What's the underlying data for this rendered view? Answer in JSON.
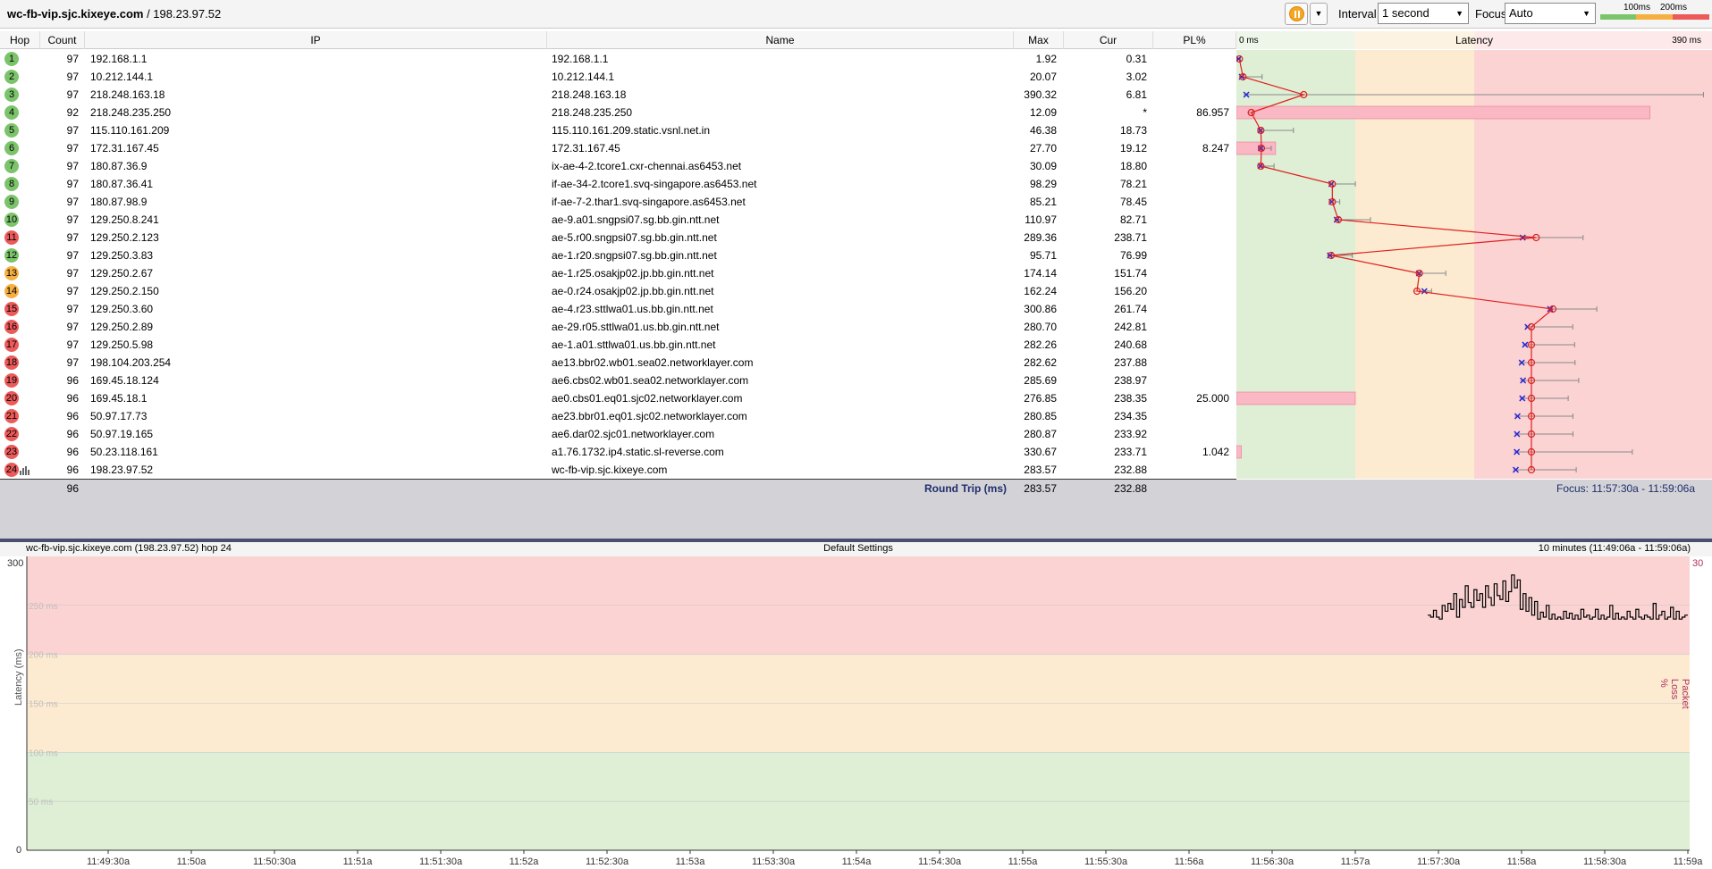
{
  "toolbar": {
    "target_host": "wc-fb-vip.sjc.kixeye.com",
    "target_ip": " / 198.23.97.52",
    "interval_label": "Interval",
    "interval_value": "1 second",
    "focus_label": "Focus",
    "focus_value": "Auto",
    "legend_100": "100ms",
    "legend_200": "200ms"
  },
  "columns": {
    "hop": "Hop",
    "count": "Count",
    "ip": "IP",
    "name": "Name",
    "max": "Max",
    "cur": "Cur",
    "pl": "PL%",
    "latency": "Latency",
    "latency_min": "0 ms",
    "latency_max": "390 ms"
  },
  "hops": [
    {
      "hop": "1",
      "count": "97",
      "ip": "192.168.1.1",
      "name": "192.168.1.1",
      "max": "1.92",
      "cur": "0.31",
      "pl": "",
      "status": "green",
      "avg": 1.0
    },
    {
      "hop": "2",
      "count": "97",
      "ip": "10.212.144.1",
      "name": "10.212.144.1",
      "max": "20.07",
      "cur": "3.02",
      "pl": "",
      "status": "green",
      "avg": 4.0
    },
    {
      "hop": "3",
      "count": "97",
      "ip": "218.248.163.18",
      "name": "218.248.163.18",
      "max": "390.32",
      "cur": "6.81",
      "pl": "",
      "status": "green",
      "avg": 55.0
    },
    {
      "hop": "4",
      "count": "92",
      "ip": "218.248.235.250",
      "name": "218.248.235.250",
      "max": "12.09",
      "cur": "*",
      "pl": "86.957",
      "status": "green",
      "avg": 11.0
    },
    {
      "hop": "5",
      "count": "97",
      "ip": "115.110.161.209",
      "name": "115.110.161.209.static.vsnl.net.in",
      "max": "46.38",
      "cur": "18.73",
      "pl": "",
      "status": "green",
      "avg": 19.0
    },
    {
      "hop": "6",
      "count": "97",
      "ip": "172.31.167.45",
      "name": "172.31.167.45",
      "max": "27.70",
      "cur": "19.12",
      "pl": "8.247",
      "status": "green",
      "avg": 19.5
    },
    {
      "hop": "7",
      "count": "97",
      "ip": "180.87.36.9",
      "name": "ix-ae-4-2.tcore1.cxr-chennai.as6453.net",
      "max": "30.09",
      "cur": "18.80",
      "pl": "",
      "status": "green",
      "avg": 19.0
    },
    {
      "hop": "8",
      "count": "97",
      "ip": "180.87.36.41",
      "name": "if-ae-34-2.tcore1.svq-singapore.as6453.net",
      "max": "98.29",
      "cur": "78.21",
      "pl": "",
      "status": "green",
      "avg": 79.0
    },
    {
      "hop": "9",
      "count": "97",
      "ip": "180.87.98.9",
      "name": "if-ae-7-2.thar1.svq-singapore.as6453.net",
      "max": "85.21",
      "cur": "78.45",
      "pl": "",
      "status": "green",
      "avg": 79.0
    },
    {
      "hop": "10",
      "count": "97",
      "ip": "129.250.8.241",
      "name": "ae-9.a01.sngpsi07.sg.bb.gin.ntt.net",
      "max": "110.97",
      "cur": "82.71",
      "pl": "",
      "status": "green",
      "avg": 84.0
    },
    {
      "hop": "11",
      "count": "97",
      "ip": "129.250.2.123",
      "name": "ae-5.r00.sngpsi07.sg.bb.gin.ntt.net",
      "max": "289.36",
      "cur": "238.71",
      "pl": "",
      "status": "red",
      "avg": 250.0
    },
    {
      "hop": "12",
      "count": "97",
      "ip": "129.250.3.83",
      "name": "ae-1.r20.sngpsi07.sg.bb.gin.ntt.net",
      "max": "95.71",
      "cur": "76.99",
      "pl": "",
      "status": "green",
      "avg": 78.0
    },
    {
      "hop": "13",
      "count": "97",
      "ip": "129.250.2.67",
      "name": "ae-1.r25.osakjp02.jp.bb.gin.ntt.net",
      "max": "174.14",
      "cur": "151.74",
      "pl": "",
      "status": "orange",
      "avg": 152.0
    },
    {
      "hop": "14",
      "count": "97",
      "ip": "129.250.2.150",
      "name": "ae-0.r24.osakjp02.jp.bb.gin.ntt.net",
      "max": "162.24",
      "cur": "156.20",
      "pl": "",
      "status": "orange",
      "avg": 150.0
    },
    {
      "hop": "15",
      "count": "97",
      "ip": "129.250.3.60",
      "name": "ae-4.r23.sttlwa01.us.bb.gin.ntt.net",
      "max": "300.86",
      "cur": "261.74",
      "pl": "",
      "status": "red",
      "avg": 264.0
    },
    {
      "hop": "16",
      "count": "97",
      "ip": "129.250.2.89",
      "name": "ae-29.r05.sttlwa01.us.bb.gin.ntt.net",
      "max": "280.70",
      "cur": "242.81",
      "pl": "",
      "status": "red",
      "avg": 246.0
    },
    {
      "hop": "17",
      "count": "97",
      "ip": "129.250.5.98",
      "name": "ae-1.a01.sttlwa01.us.bb.gin.ntt.net",
      "max": "282.26",
      "cur": "240.68",
      "pl": "",
      "status": "red",
      "avg": 246.0
    },
    {
      "hop": "18",
      "count": "97",
      "ip": "198.104.203.254",
      "name": "ae13.bbr02.wb01.sea02.networklayer.com",
      "max": "282.62",
      "cur": "237.88",
      "pl": "",
      "status": "red",
      "avg": 246.0
    },
    {
      "hop": "19",
      "count": "96",
      "ip": "169.45.18.124",
      "name": "ae6.cbs02.wb01.sea02.networklayer.com",
      "max": "285.69",
      "cur": "238.97",
      "pl": "",
      "status": "red",
      "avg": 246.0
    },
    {
      "hop": "20",
      "count": "96",
      "ip": "169.45.18.1",
      "name": "ae0.cbs01.eq01.sjc02.networklayer.com",
      "max": "276.85",
      "cur": "238.35",
      "pl": "25.000",
      "status": "red",
      "avg": 246.0
    },
    {
      "hop": "21",
      "count": "96",
      "ip": "50.97.17.73",
      "name": "ae23.bbr01.eq01.sjc02.networklayer.com",
      "max": "280.85",
      "cur": "234.35",
      "pl": "",
      "status": "red",
      "avg": 246.0
    },
    {
      "hop": "22",
      "count": "96",
      "ip": "50.97.19.165",
      "name": "ae6.dar02.sjc01.networklayer.com",
      "max": "280.87",
      "cur": "233.92",
      "pl": "",
      "status": "red",
      "avg": 246.0
    },
    {
      "hop": "23",
      "count": "96",
      "ip": "50.23.118.161",
      "name": "a1.76.1732.ip4.static.sl-reverse.com",
      "max": "330.67",
      "cur": "233.71",
      "pl": "1.042",
      "status": "red",
      "avg": 246.0
    },
    {
      "hop": "24",
      "count": "96",
      "ip": "198.23.97.52",
      "name": "wc-fb-vip.sjc.kixeye.com",
      "max": "283.57",
      "cur": "232.88",
      "pl": "",
      "status": "red",
      "avg": 246.0
    }
  ],
  "summary": {
    "count": "96",
    "label": "Round Trip (ms)",
    "max": "283.57",
    "cur": "232.88",
    "focus_range": "Focus: 11:57:30a - 11:59:06a"
  },
  "history": {
    "title": "wc-fb-vip.sjc.kixeye.com (198.23.97.52) hop 24",
    "settings": "Default Settings",
    "range": "10 minutes (11:49:06a - 11:59:06a)",
    "y_axis_title": "Latency (ms)",
    "right_axis_title": "Packet Loss %",
    "y_top": "300",
    "y_bottom": "0",
    "y_right_top": "30",
    "gridline_labels": [
      "250 ms",
      "200 ms",
      "150 ms",
      "100 ms",
      "50 ms"
    ],
    "time_labels": [
      "11:49:30a",
      "11:50a",
      "11:50:30a",
      "11:51a",
      "11:51:30a",
      "11:52a",
      "11:52:30a",
      "11:53a",
      "11:53:30a",
      "11:54a",
      "11:54:30a",
      "11:55a",
      "11:55:30a",
      "11:56a",
      "11:56:30a",
      "11:57a",
      "11:57:30a",
      "11:58a",
      "11:58:30a",
      "11:59a"
    ],
    "series_ms": [
      240,
      238,
      245,
      238,
      236,
      250,
      244,
      252,
      246,
      262,
      238,
      256,
      248,
      270,
      253,
      248,
      266,
      255,
      262,
      248,
      270,
      258,
      250,
      272,
      260,
      256,
      275,
      254,
      264,
      281,
      268,
      276,
      246,
      262,
      244,
      258,
      240,
      254,
      236,
      243,
      238,
      250,
      236,
      241,
      236,
      238,
      236,
      244,
      237,
      242,
      236,
      240,
      236,
      246,
      238,
      240,
      236,
      238,
      246,
      236,
      240,
      236,
      238,
      250,
      236,
      242,
      236,
      238,
      236,
      244,
      238,
      236,
      246,
      238,
      236,
      240,
      238,
      236,
      252,
      236,
      240,
      244,
      236,
      238,
      248,
      236,
      244,
      236,
      238,
      240
    ]
  },
  "colors": {
    "zone_green": "#deefd5",
    "zone_orange": "#fcebd0",
    "zone_red": "#fcd3d3",
    "pl_bar": "#f9b8c4",
    "avg_line": "#e02020",
    "cur_marker": "#2525d8"
  }
}
